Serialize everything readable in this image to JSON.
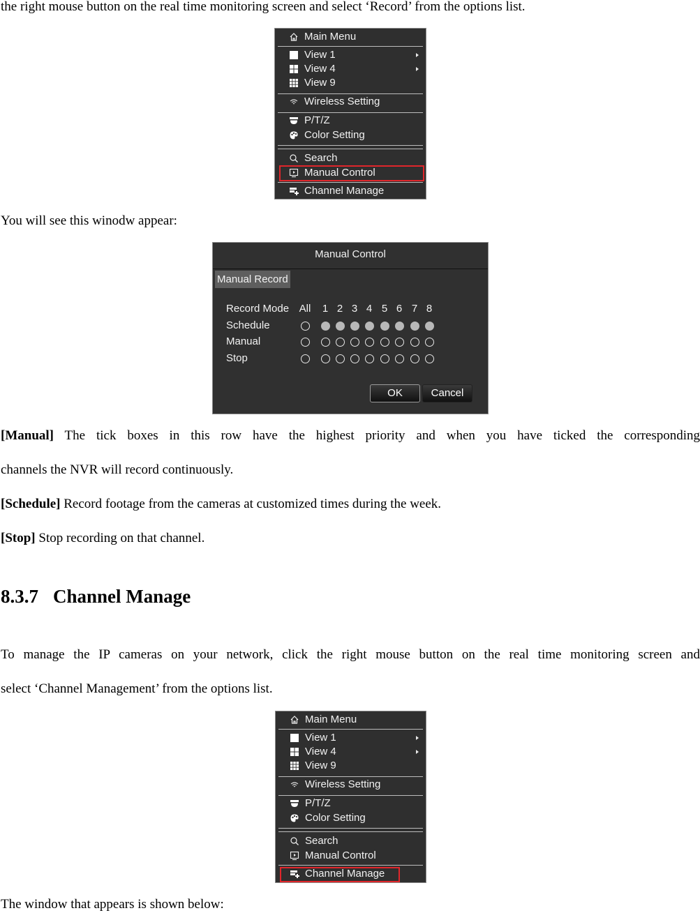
{
  "text": {
    "intro_line": "the right mouse button on the real time monitoring screen and select ‘Record’ from the options list.",
    "window_appear": "You will see this winodw appear:",
    "manual_label": "[Manual]",
    "manual_desc_1": " The tick boxes in this row have the highest priority and when you have ticked the corresponding",
    "manual_desc_2": "channels the NVR will record continuously.",
    "schedule_label": "[Schedule]",
    "schedule_desc": " Record footage from the cameras at customized times during the week.",
    "stop_label": "[Stop]",
    "stop_desc": " Stop recording on that channel.",
    "section_number": "8.3.7",
    "section_title": "Channel Manage",
    "channel_intro_1": "To manage the IP cameras on your network, click the right mouse button on the real time monitoring screen and",
    "channel_intro_2": "select ‘Channel Management’ from the options list.",
    "window_below": "The window that appears is shown below:"
  },
  "context_menu": {
    "items": [
      {
        "label": "Main Menu",
        "icon": "home-icon"
      },
      {
        "label": "View 1",
        "icon": "single-view-icon",
        "submenu": true
      },
      {
        "label": "View 4",
        "icon": "quad-view-icon",
        "submenu": true
      },
      {
        "label": "View 9",
        "icon": "nine-view-icon"
      },
      {
        "label": "Wireless Setting",
        "icon": "wifi-icon"
      },
      {
        "label": "P/T/Z",
        "icon": "ptz-camera-icon"
      },
      {
        "label": "Color Setting",
        "icon": "palette-icon"
      },
      {
        "label": "Search",
        "icon": "search-icon"
      },
      {
        "label": "Manual Control",
        "icon": "playback-monitor-icon"
      },
      {
        "label": "Channel Manage",
        "icon": "channel-add-icon"
      }
    ],
    "highlight_color": "#e0262b",
    "first_highlighted": "Manual Control",
    "second_highlighted": "Channel Manage"
  },
  "manual_control": {
    "title": "Manual Control",
    "tab": "Manual Record",
    "header_label": "Record Mode",
    "columns": [
      "All",
      "1",
      "2",
      "3",
      "4",
      "5",
      "6",
      "7",
      "8"
    ],
    "rows": [
      {
        "label": "Schedule",
        "selected": [
          false,
          true,
          true,
          true,
          true,
          true,
          true,
          true,
          true
        ]
      },
      {
        "label": "Manual",
        "selected": [
          false,
          false,
          false,
          false,
          false,
          false,
          false,
          false,
          false
        ]
      },
      {
        "label": "Stop",
        "selected": [
          false,
          false,
          false,
          false,
          false,
          false,
          false,
          false,
          false
        ]
      }
    ],
    "ok_label": "OK",
    "cancel_label": "Cancel"
  }
}
